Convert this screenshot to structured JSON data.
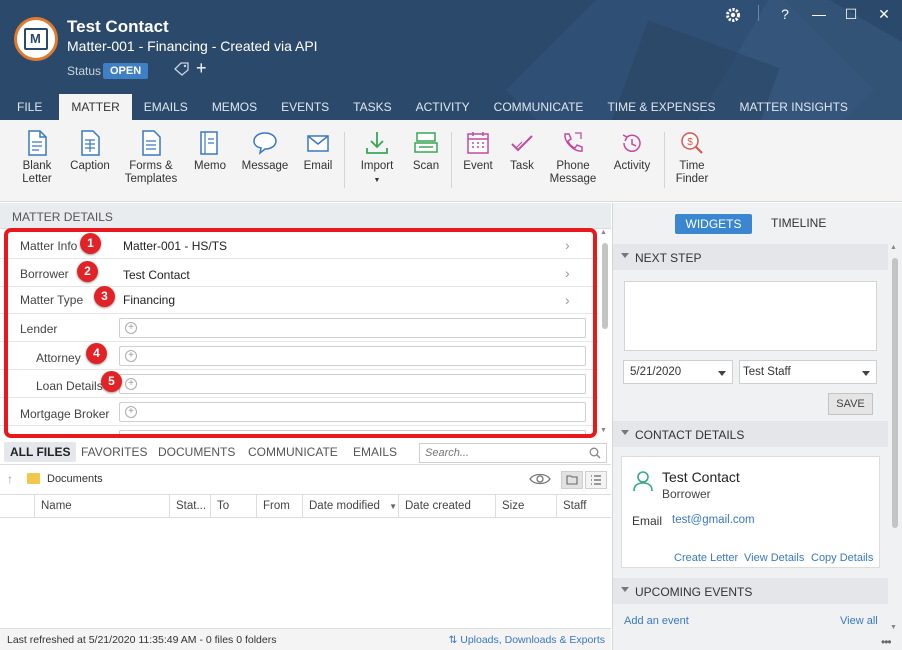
{
  "header": {
    "title": "Test Contact",
    "subtitle": "Matter-001 - Financing - Created via API",
    "status_label": "Status",
    "status_value": "OPEN",
    "window_controls": [
      "gear-icon",
      "?",
      "—",
      "☐",
      "✕"
    ]
  },
  "tabs": [
    "FILE",
    "MATTER",
    "EMAILS",
    "MEMOS",
    "EVENTS",
    "TASKS",
    "ACTIVITY",
    "COMMUNICATE",
    "TIME & EXPENSES",
    "MATTER INSIGHTS"
  ],
  "ribbon": {
    "blank_letter": [
      "Blank",
      "Letter"
    ],
    "caption": "Caption",
    "forms": [
      "Forms &",
      "Templates"
    ],
    "memo": "Memo",
    "message": "Message",
    "email": "Email",
    "import": "Import",
    "scan": "Scan",
    "event": "Event",
    "task": "Task",
    "phone_message": [
      "Phone",
      "Message"
    ],
    "activity": "Activity",
    "time_finder": [
      "Time",
      "Finder"
    ]
  },
  "matter_details": {
    "header": "MATTER DETAILS",
    "rows": [
      {
        "label": "Matter Info",
        "value": "Matter-001 - HS/TS",
        "marker": "1"
      },
      {
        "label": "Borrower",
        "value": "Test Contact",
        "marker": "2"
      },
      {
        "label": "Matter Type",
        "value": "Financing",
        "marker": "3"
      },
      {
        "label": "Lender",
        "value": ""
      },
      {
        "label": "Attorney",
        "value": "",
        "marker": "4"
      },
      {
        "label": "Loan Details",
        "value": "",
        "marker": "5"
      },
      {
        "label": "Mortgage Broker",
        "value": ""
      }
    ]
  },
  "files": {
    "tabs": [
      "ALL FILES",
      "FAVORITES",
      "DOCUMENTS",
      "COMMUNICATE",
      "EMAILS"
    ],
    "search_placeholder": "Search...",
    "breadcrumb": "Documents",
    "columns": [
      "Name",
      "Stat...",
      "To",
      "From",
      "Date modified",
      "Date created",
      "Size",
      "Staff"
    ],
    "footer_status": "Last refreshed at 5/21/2020 11:35:49 AM  -  0 files  0 folders",
    "footer_link": "Uploads, Downloads & Exports"
  },
  "right_panel": {
    "widgets_label": "WIDGETS",
    "timeline_label": "TIMELINE",
    "next_step": {
      "header": "NEXT STEP",
      "date": "5/21/2020",
      "staff": "Test Staff",
      "save_label": "SAVE"
    },
    "contact_details": {
      "header": "CONTACT DETAILS",
      "name": "Test Contact",
      "role": "Borrower",
      "email_label": "Email",
      "email": "test@gmail.com",
      "links": [
        "Create Letter",
        "View Details",
        "Copy Details"
      ]
    },
    "upcoming_events": {
      "header": "UPCOMING EVENTS",
      "add_label": "Add an event",
      "view_all_label": "View all"
    }
  },
  "colors": {
    "header_bg": "#2b4a6b",
    "accent_blue": "#3a86d0",
    "highlight_red": "#e8181c",
    "link_blue": "#3a78c2"
  }
}
